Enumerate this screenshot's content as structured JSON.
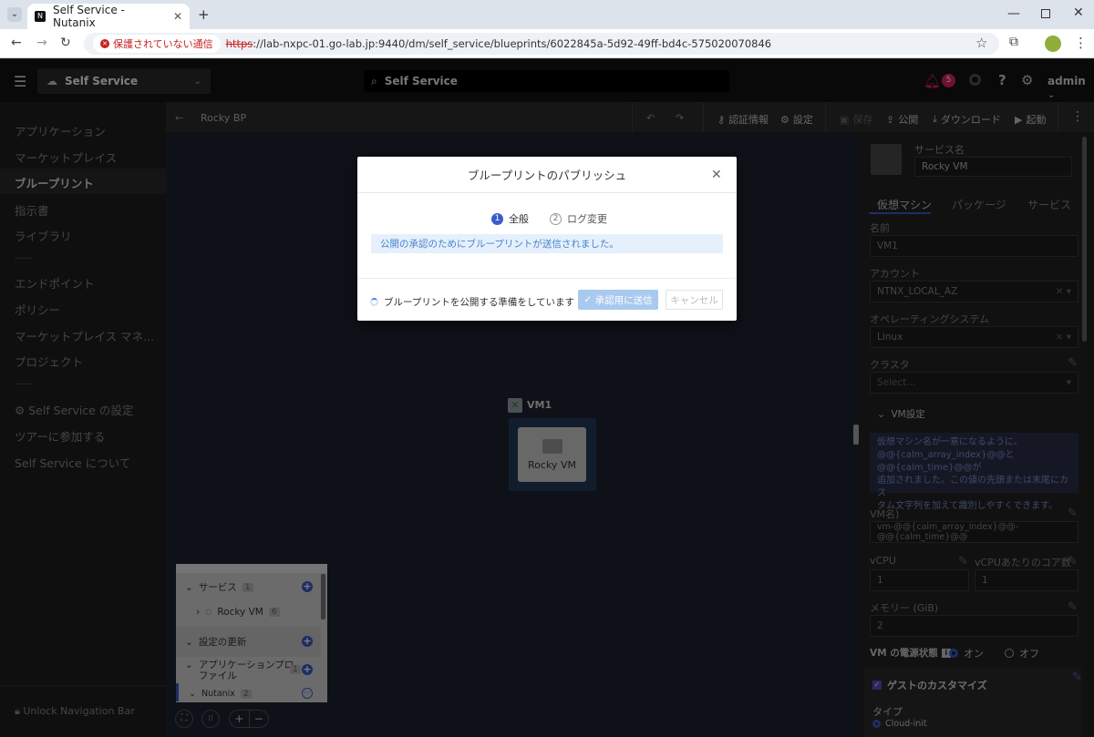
{
  "browser": {
    "tab_title": "Self Service - Nutanix",
    "security_label": "保護されていない通信",
    "url_scheme": "https",
    "url_rest": "://lab-nxpc-01.go-lab.jp:9440/dm/self_service/blueprints/6022845a-5d92-49ff-bd4c-575020070846"
  },
  "header": {
    "app_name": "Self Service",
    "search_text": "Self Service",
    "alert_count": "5",
    "user": "admin"
  },
  "sidebar": {
    "items": [
      "アプリケーション",
      "マーケットプレイス",
      "ブループリント",
      "指示書",
      "ライブラリ"
    ],
    "items2": [
      "エンドポイント",
      "ポリシー",
      "マーケットプレイス マネ...",
      "プロジェクト"
    ],
    "items3": [
      "Self Service の設定",
      "ツアーに参加する",
      "Self Service について"
    ],
    "unlock": "Unlock Navigation Bar"
  },
  "toolbar": {
    "bp_name": "Rocky BP",
    "credentials": "認証情報",
    "settings": "設定",
    "save": "保存",
    "publish": "公開",
    "download": "ダウンロード",
    "launch": "起動"
  },
  "canvas": {
    "vm_label": "VM1",
    "service_name": "Rocky VM"
  },
  "mini": {
    "services": "サービス",
    "services_count": "1",
    "rocky_vm": "Rocky VM",
    "rocky_count": "6",
    "update": "設定の更新",
    "profile_line1": "アプリケーションプロ",
    "profile_line2": "ファイル",
    "profile_count": "1",
    "nutanix": "Nutanix",
    "nutanix_count": "2"
  },
  "panel": {
    "service_name_label": "サービス名",
    "service_name_value": "Rocky VM",
    "tabs": [
      "仮想マシン",
      "パッケージ",
      "サービス"
    ],
    "name_label": "名前",
    "name_value": "VM1",
    "account_label": "アカウント",
    "account_value": "NTNX_LOCAL_AZ",
    "os_label": "オペレーティングシステム",
    "os_value": "Linux",
    "cluster_label": "クラスタ",
    "cluster_placeholder": "Select...",
    "vm_settings": "VM設定",
    "info_text_1": "仮想マシン名が一意になるように、",
    "info_text_2": "@@{calm_array_index}@@と@@{calm_time}@@が",
    "info_text_3": "追加されました。この値の先頭または末尾にカス",
    "info_text_4": "タム文字列を加えて識別しやすくできます。",
    "vm_name_label": "VM名)",
    "vm_name_value": "vm-@@{calm_array_index}@@-@@{calm_time}@@",
    "vcpu_label": "vCPU",
    "vcpu_value": "1",
    "cores_label": "vCPUあたりのコア数",
    "cores_value": "1",
    "memory_label": "メモリー (GiB)",
    "memory_value": "2",
    "power_label": "VM の電源状態",
    "power_on": "オン",
    "power_off": "オフ",
    "guest_custom": "ゲストのカスタマイズ",
    "type_label": "タイプ",
    "cloud_init": "Cloud-init"
  },
  "modal": {
    "title": "ブループリントのパブリッシュ",
    "step1": "全般",
    "step2": "ログ変更",
    "info": "公開の承認のためにブループリントが送信されました。",
    "status": "ブループリントを公開する準備をしています",
    "submit": "承認用に送信",
    "cancel": "キャンセル"
  },
  "colors": {
    "accent": "#3b5ccc",
    "alert": "#e0245e"
  }
}
